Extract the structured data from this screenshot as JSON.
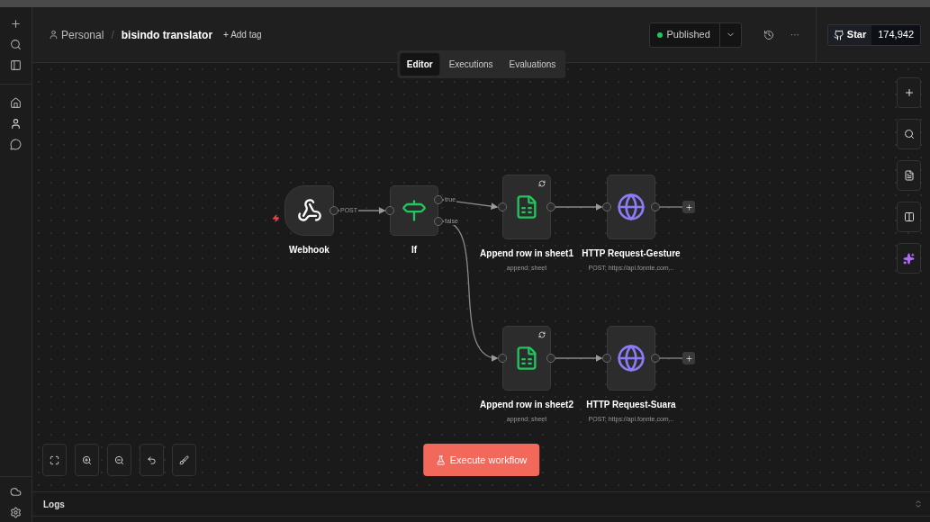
{
  "breadcrumb": {
    "owner": "Personal",
    "separator": "/",
    "workflow": "bisindo translator",
    "add_tag": "+ Add tag"
  },
  "tabs": [
    {
      "label": "Editor",
      "selected": true
    },
    {
      "label": "Executions",
      "selected": false
    },
    {
      "label": "Evaluations",
      "selected": false
    }
  ],
  "status": {
    "label": "Published"
  },
  "more": "···",
  "github": {
    "label": "Star",
    "count": "174,942"
  },
  "nodes": [
    {
      "kind": "trigger",
      "title": "Webhook",
      "outputs": [
        "POST"
      ]
    },
    {
      "kind": "if",
      "title": "If",
      "outputs": [
        "true",
        "false"
      ]
    },
    {
      "kind": "sheets",
      "title": "Append row in sheet1",
      "subtitle": "append: sheet"
    },
    {
      "kind": "http",
      "title": "HTTP Request-Gesture",
      "subtitle": "POST: https://api.fonnte.com..."
    },
    {
      "kind": "sheets",
      "title": "Append row in sheet2",
      "subtitle": "append: sheet"
    },
    {
      "kind": "http",
      "title": "HTTP Request-Suara",
      "subtitle": "POST: https://api.fonnte.com..."
    }
  ],
  "execute_button": "Execute workflow",
  "logs": {
    "title": "Logs"
  }
}
